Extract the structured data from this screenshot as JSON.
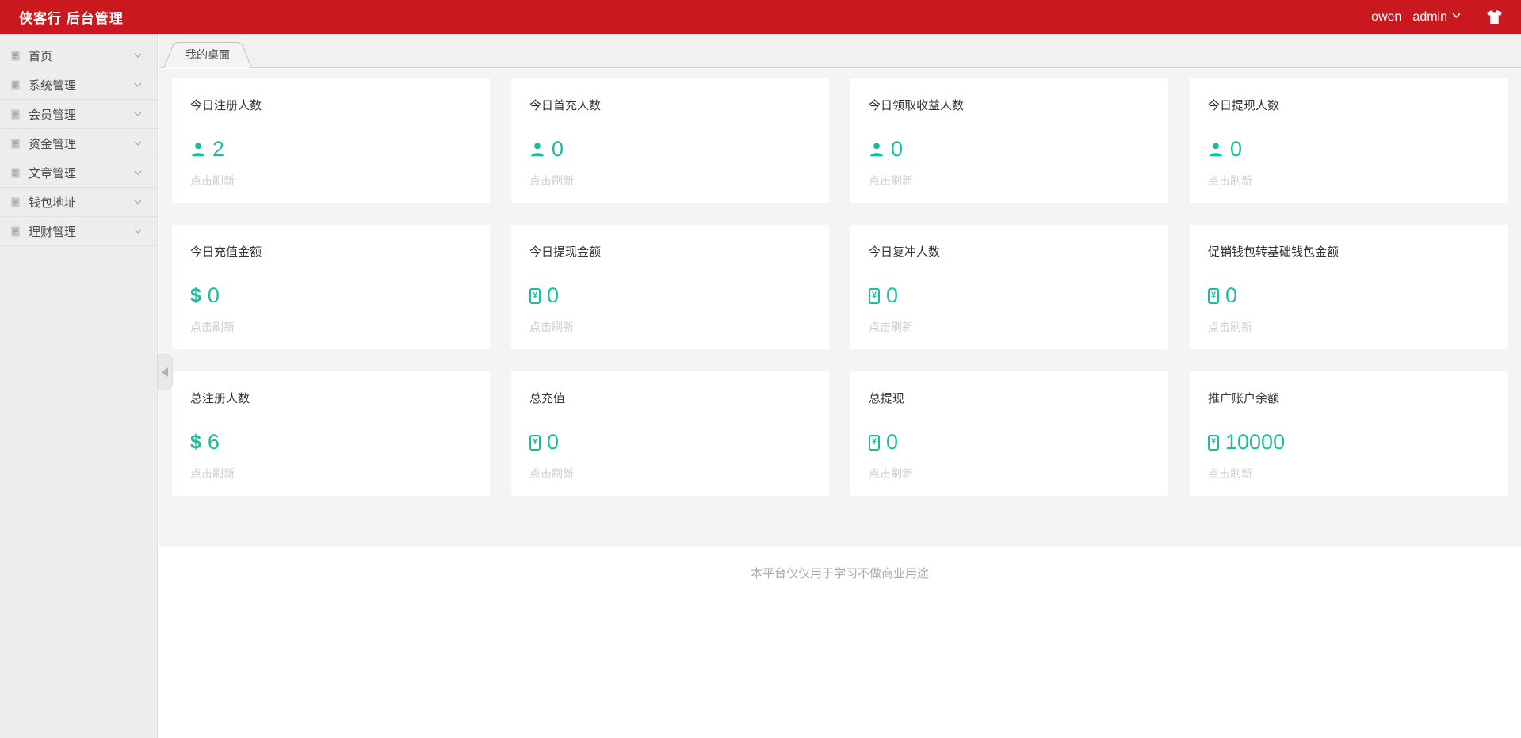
{
  "colors": {
    "accent_red": "#c9191f",
    "teal": "#1abc9c"
  },
  "header": {
    "title": "侠客行 后台管理",
    "username": "owen",
    "role_menu": "admin"
  },
  "sidebar": {
    "items": [
      {
        "label": "首页"
      },
      {
        "label": "系统管理"
      },
      {
        "label": "会员管理"
      },
      {
        "label": "资金管理"
      },
      {
        "label": "文章管理"
      },
      {
        "label": "钱包地址"
      },
      {
        "label": "理财管理"
      }
    ]
  },
  "tabs": {
    "active_label": "我的桌面"
  },
  "labels": {
    "refresh": "点击刷新"
  },
  "cards": [
    {
      "title": "今日注册人数",
      "icon": "person-icon",
      "value": "2"
    },
    {
      "title": "今日首充人数",
      "icon": "person-icon",
      "value": "0"
    },
    {
      "title": "今日领取收益人数",
      "icon": "person-icon",
      "value": "0"
    },
    {
      "title": "今日提现人数",
      "icon": "person-icon",
      "value": "0"
    },
    {
      "title": "今日充值金额",
      "icon": "dollar-icon",
      "value": "0"
    },
    {
      "title": "今日提现金额",
      "icon": "bill-icon",
      "value": "0"
    },
    {
      "title": "今日复冲人数",
      "icon": "bill-icon",
      "value": "0"
    },
    {
      "title": "促销钱包转基础钱包金额",
      "icon": "bill-icon",
      "value": "0"
    },
    {
      "title": "总注册人数",
      "icon": "dollar-icon",
      "value": "6"
    },
    {
      "title": "总充值",
      "icon": "bill-icon",
      "value": "0"
    },
    {
      "title": "总提现",
      "icon": "bill-icon",
      "value": "0"
    },
    {
      "title": "推广账户余额",
      "icon": "bill-icon",
      "value": "10000"
    }
  ],
  "footer": {
    "note": "本平台仅仅用于学习不做商业用途"
  }
}
